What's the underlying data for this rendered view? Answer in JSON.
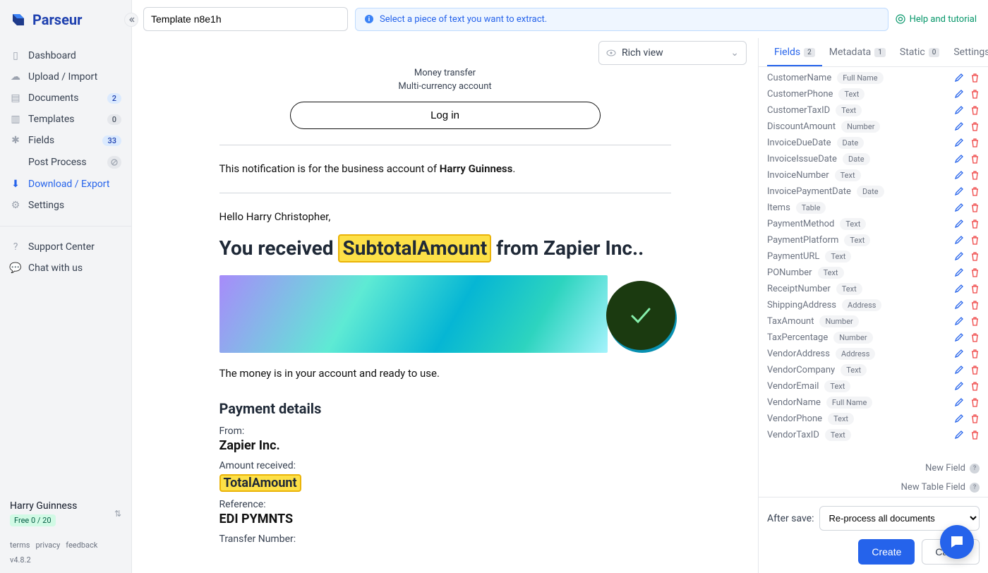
{
  "brand": "Parseur",
  "templateName": "Template n8e1h",
  "banner": "Select a piece of text you want to extract.",
  "helpLink": "Help and tutorial",
  "viewSelector": "Rich view",
  "sidebar": {
    "items": [
      {
        "label": "Dashboard",
        "badge": ""
      },
      {
        "label": "Upload / Import",
        "badge": ""
      },
      {
        "label": "Documents",
        "badge": "2"
      },
      {
        "label": "Templates",
        "badge": "0"
      },
      {
        "label": "Fields",
        "badge": "33"
      },
      {
        "label": "Post Process",
        "badge": "ban"
      },
      {
        "label": "Download / Export",
        "badge": "",
        "active": true
      },
      {
        "label": "Settings",
        "badge": ""
      }
    ],
    "support": [
      {
        "label": "Support Center"
      },
      {
        "label": "Chat with us"
      }
    ]
  },
  "user": {
    "name": "Harry Guinness",
    "plan": "Free 0 / 20"
  },
  "footerLinks": [
    "terms",
    "privacy",
    "feedback",
    "v4.8.2"
  ],
  "doc": {
    "line1": "Money transfer",
    "line2": "Multi-currency account",
    "login": "Log in",
    "notice_pre": "This notification is for the business account of ",
    "notice_name": "Harry Guinness",
    "hello": "Hello Harry Christopher,",
    "headline_pre": "You received ",
    "headline_chip": "SubtotalAmount",
    "headline_post": " from Zapier Inc..",
    "ready": "The money is in your account and ready to use.",
    "pd_heading": "Payment details",
    "from_lbl": "From:",
    "from_val": "Zapier Inc.",
    "amt_lbl": "Amount received:",
    "amt_chip": "TotalAmount",
    "ref_lbl": "Reference:",
    "ref_val": "EDI PYMNTS",
    "tn_lbl": "Transfer Number:"
  },
  "tabs": {
    "fields": {
      "label": "Fields",
      "count": "2"
    },
    "metadata": {
      "label": "Metadata",
      "count": "1"
    },
    "static": {
      "label": "Static",
      "count": "0"
    },
    "settings": {
      "label": "Settings"
    }
  },
  "fields": [
    {
      "name": "CustomerName",
      "type": "Full Name"
    },
    {
      "name": "CustomerPhone",
      "type": "Text"
    },
    {
      "name": "CustomerTaxID",
      "type": "Text"
    },
    {
      "name": "DiscountAmount",
      "type": "Number"
    },
    {
      "name": "InvoiceDueDate",
      "type": "Date"
    },
    {
      "name": "InvoiceIssueDate",
      "type": "Date"
    },
    {
      "name": "InvoiceNumber",
      "type": "Text"
    },
    {
      "name": "InvoicePaymentDate",
      "type": "Date"
    },
    {
      "name": "Items",
      "type": "Table"
    },
    {
      "name": "PaymentMethod",
      "type": "Text"
    },
    {
      "name": "PaymentPlatform",
      "type": "Text"
    },
    {
      "name": "PaymentURL",
      "type": "Text"
    },
    {
      "name": "PONumber",
      "type": "Text"
    },
    {
      "name": "ReceiptNumber",
      "type": "Text"
    },
    {
      "name": "ShippingAddress",
      "type": "Address"
    },
    {
      "name": "TaxAmount",
      "type": "Number"
    },
    {
      "name": "TaxPercentage",
      "type": "Number"
    },
    {
      "name": "VendorAddress",
      "type": "Address"
    },
    {
      "name": "VendorCompany",
      "type": "Text"
    },
    {
      "name": "VendorEmail",
      "type": "Text"
    },
    {
      "name": "VendorName",
      "type": "Full Name"
    },
    {
      "name": "VendorPhone",
      "type": "Text"
    },
    {
      "name": "VendorTaxID",
      "type": "Text"
    }
  ],
  "newField": "New Field",
  "newTableField": "New Table Field",
  "afterSave": {
    "label": "After save:",
    "value": "Re-process all documents"
  },
  "buttons": {
    "create": "Create",
    "cancel": "Cancel"
  }
}
